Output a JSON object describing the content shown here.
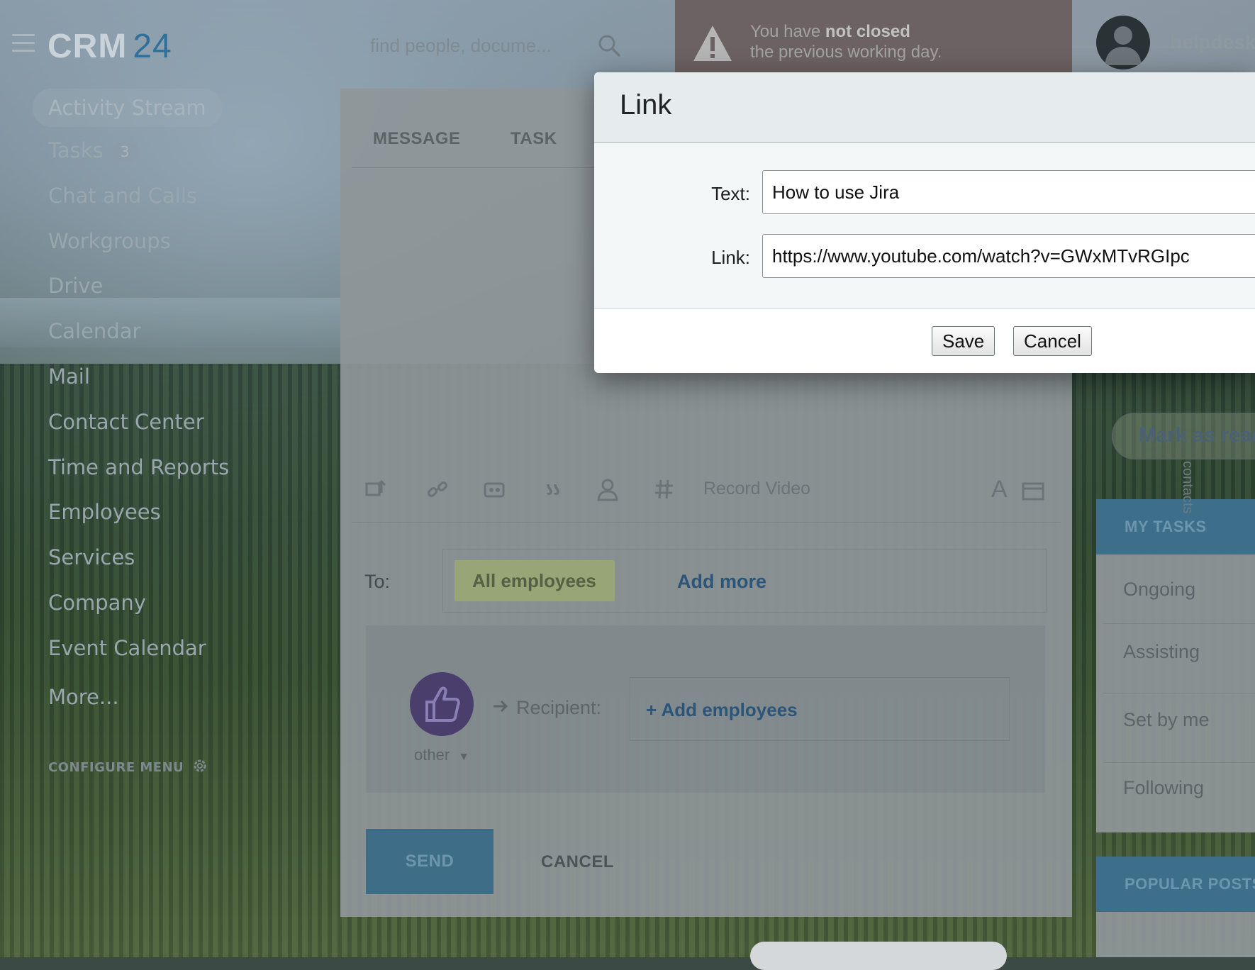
{
  "header": {
    "logo_text": "CRM",
    "logo_number": "24",
    "search_placeholder": "find people, docume...",
    "warning_line1_prefix": "You have ",
    "warning_line1_bold": "not closed",
    "warning_line2": "the previous working day.",
    "username": "helpdesk"
  },
  "sidebar": {
    "items": [
      {
        "label": "Activity Stream"
      },
      {
        "label": "Tasks",
        "badge": "3"
      },
      {
        "label": "Chat and Calls"
      },
      {
        "label": "Workgroups"
      },
      {
        "label": "Drive"
      },
      {
        "label": "Calendar"
      },
      {
        "label": "Mail"
      },
      {
        "label": "Contact Center"
      },
      {
        "label": "Time and Reports"
      },
      {
        "label": "Employees"
      },
      {
        "label": "Services"
      },
      {
        "label": "Company"
      },
      {
        "label": "Event Calendar"
      },
      {
        "label": "More..."
      }
    ],
    "configure_label": "CONFIGURE MENU"
  },
  "post_form": {
    "tabs": [
      "MESSAGE",
      "TASK"
    ],
    "record_video": "Record Video",
    "format_letter": "A",
    "to_label": "To:",
    "recipient_chip": "All employees",
    "add_more": "Add more",
    "recipient_label": "Recipient:",
    "add_employees": "+ Add employees",
    "badge_type": "other",
    "send": "SEND",
    "cancel": "CANCEL"
  },
  "right_column": {
    "mark_as_read": "Mark as read",
    "contacts_tab": "contacts",
    "my_tasks_title": "MY TASKS",
    "tasks": [
      "Ongoing",
      "Assisting",
      "Set by me",
      "Following"
    ],
    "popular_posts_title": "POPULAR POSTS"
  },
  "dialog": {
    "title": "Link",
    "text_label": "Text:",
    "text_value": "How to use Jira",
    "link_label": "Link:",
    "link_value": "https://www.youtube.com/watch?v=GWxMTvRGIpc",
    "save": "Save",
    "cancel": "Cancel"
  },
  "colors": {
    "overlay_dim": "#8f9699",
    "accent_blue": "#3d6f8b",
    "chip_green": "#98a577",
    "thumb_purple": "#493e6c"
  }
}
